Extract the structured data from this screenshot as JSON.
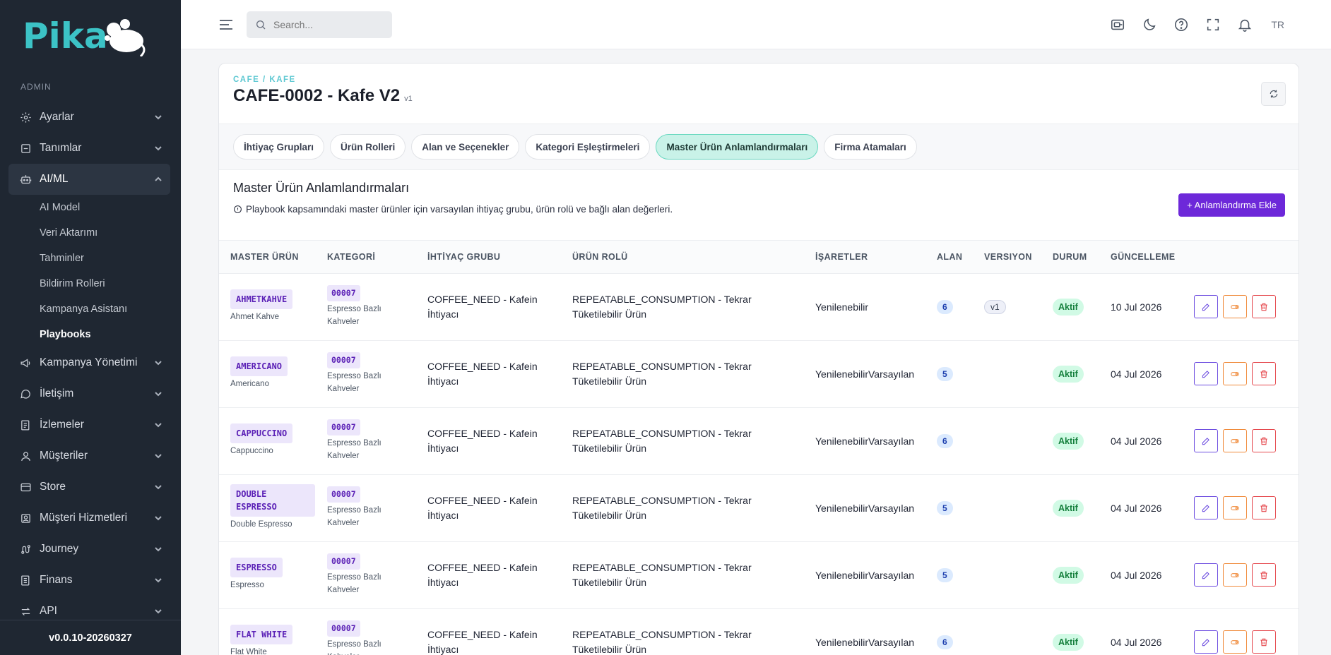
{
  "app": {
    "logo_text": "Pika"
  },
  "sidebar": {
    "section_label": "ADMIN",
    "items": [
      {
        "label": "Ayarlar",
        "icon": "gear-icon"
      },
      {
        "label": "Tanımlar",
        "icon": "tag-icon"
      },
      {
        "label": "AI/ML",
        "icon": "robot-icon"
      },
      {
        "label": "Kampanya Yönetimi",
        "icon": "megaphone-icon"
      },
      {
        "label": "İletişim",
        "icon": "chat-icon"
      },
      {
        "label": "İzlemeler",
        "icon": "list-icon"
      },
      {
        "label": "Müşteriler",
        "icon": "user-icon"
      },
      {
        "label": "Store",
        "icon": "store-icon"
      },
      {
        "label": "Müşteri Hizmetleri",
        "icon": "support-icon"
      },
      {
        "label": "Journey",
        "icon": "route-icon"
      },
      {
        "label": "Finans",
        "icon": "finance-icon"
      },
      {
        "label": "API",
        "icon": "api-icon"
      }
    ],
    "subitems": [
      "AI Model",
      "Veri Aktarımı",
      "Tahminler",
      "Bildirim Rolleri",
      "Kampanya Asistanı",
      "Playbooks"
    ],
    "version": "v0.0.10-20260327"
  },
  "topbar": {
    "search_placeholder": "Search...",
    "lang": "TR"
  },
  "page": {
    "breadcrumb": "CAFE / KAFE",
    "title": "CAFE-0002 - Kafe V2",
    "title_version": "v1"
  },
  "tabs": [
    "İhtiyaç Grupları",
    "Ürün Rolleri",
    "Alan ve Seçenekler",
    "Kategori Eşleştirmeleri",
    "Master Ürün Anlamlandırmaları",
    "Firma Atamaları"
  ],
  "active_tab": 4,
  "section": {
    "title": "Master Ürün Anlamlandırmaları",
    "description": "Playbook kapsamındaki master ürünler için varsayılan ihtiyaç grubu, ürün rolü ve bağlı alan değerleri.",
    "add_button": "+ Anlamlandırma Ekle"
  },
  "table": {
    "columns": [
      "MASTER ÜRÜN",
      "KATEGORİ",
      "İHTİYAÇ GRUBU",
      "ÜRÜN ROLÜ",
      "İŞARETLER",
      "ALAN",
      "VERSIYON",
      "DURUM",
      "GÜNCELLEME"
    ],
    "rows": [
      {
        "code": "AHMETKAHVE",
        "name": "Ahmet Kahve",
        "cat_code": "00007",
        "cat_name": "Espresso Bazlı Kahveler",
        "need": "COFFEE_NEED - Kafein İhtiyacı",
        "role": "REPEATABLE_CONSUMPTION - Tekrar Tüketilebilir Ürün",
        "flags": "Yenilenebilir",
        "fields": "6",
        "version": "v1",
        "status": "Aktif",
        "updated": "10 Jul 2026"
      },
      {
        "code": "AMERICANO",
        "name": "Americano",
        "cat_code": "00007",
        "cat_name": "Espresso Bazlı Kahveler",
        "need": "COFFEE_NEED - Kafein İhtiyacı",
        "role": "REPEATABLE_CONSUMPTION - Tekrar Tüketilebilir Ürün",
        "flags": "YenilenebilirVarsayılan",
        "fields": "5",
        "version": "",
        "status": "Aktif",
        "updated": "04 Jul 2026"
      },
      {
        "code": "CAPPUCCINO",
        "name": "Cappuccino",
        "cat_code": "00007",
        "cat_name": "Espresso Bazlı Kahveler",
        "need": "COFFEE_NEED - Kafein İhtiyacı",
        "role": "REPEATABLE_CONSUMPTION - Tekrar Tüketilebilir Ürün",
        "flags": "YenilenebilirVarsayılan",
        "fields": "6",
        "version": "",
        "status": "Aktif",
        "updated": "04 Jul 2026"
      },
      {
        "code": "DOUBLE ESPRESSO",
        "name": "Double Espresso",
        "cat_code": "00007",
        "cat_name": "Espresso Bazlı Kahveler",
        "need": "COFFEE_NEED - Kafein İhtiyacı",
        "role": "REPEATABLE_CONSUMPTION - Tekrar Tüketilebilir Ürün",
        "flags": "YenilenebilirVarsayılan",
        "fields": "5",
        "version": "",
        "status": "Aktif",
        "updated": "04 Jul 2026"
      },
      {
        "code": "ESPRESSO",
        "name": "Espresso",
        "cat_code": "00007",
        "cat_name": "Espresso Bazlı Kahveler",
        "need": "COFFEE_NEED - Kafein İhtiyacı",
        "role": "REPEATABLE_CONSUMPTION - Tekrar Tüketilebilir Ürün",
        "flags": "YenilenebilirVarsayılan",
        "fields": "5",
        "version": "",
        "status": "Aktif",
        "updated": "04 Jul 2026"
      },
      {
        "code": "FLAT WHITE",
        "name": "Flat White",
        "cat_code": "00007",
        "cat_name": "Espresso Bazlı Kahveler",
        "need": "COFFEE_NEED - Kafein İhtiyacı",
        "role": "REPEATABLE_CONSUMPTION - Tekrar Tüketilebilir Ürün",
        "flags": "YenilenebilirVarsayılan",
        "fields": "6",
        "version": "",
        "status": "Aktif",
        "updated": "04 Jul 2026"
      }
    ]
  },
  "colors": {
    "accent": "#6d28d9",
    "teal": "#5ec8d2",
    "sidebar_bg": "#1f2732",
    "active_tab_bg": "#c9f2e8"
  }
}
